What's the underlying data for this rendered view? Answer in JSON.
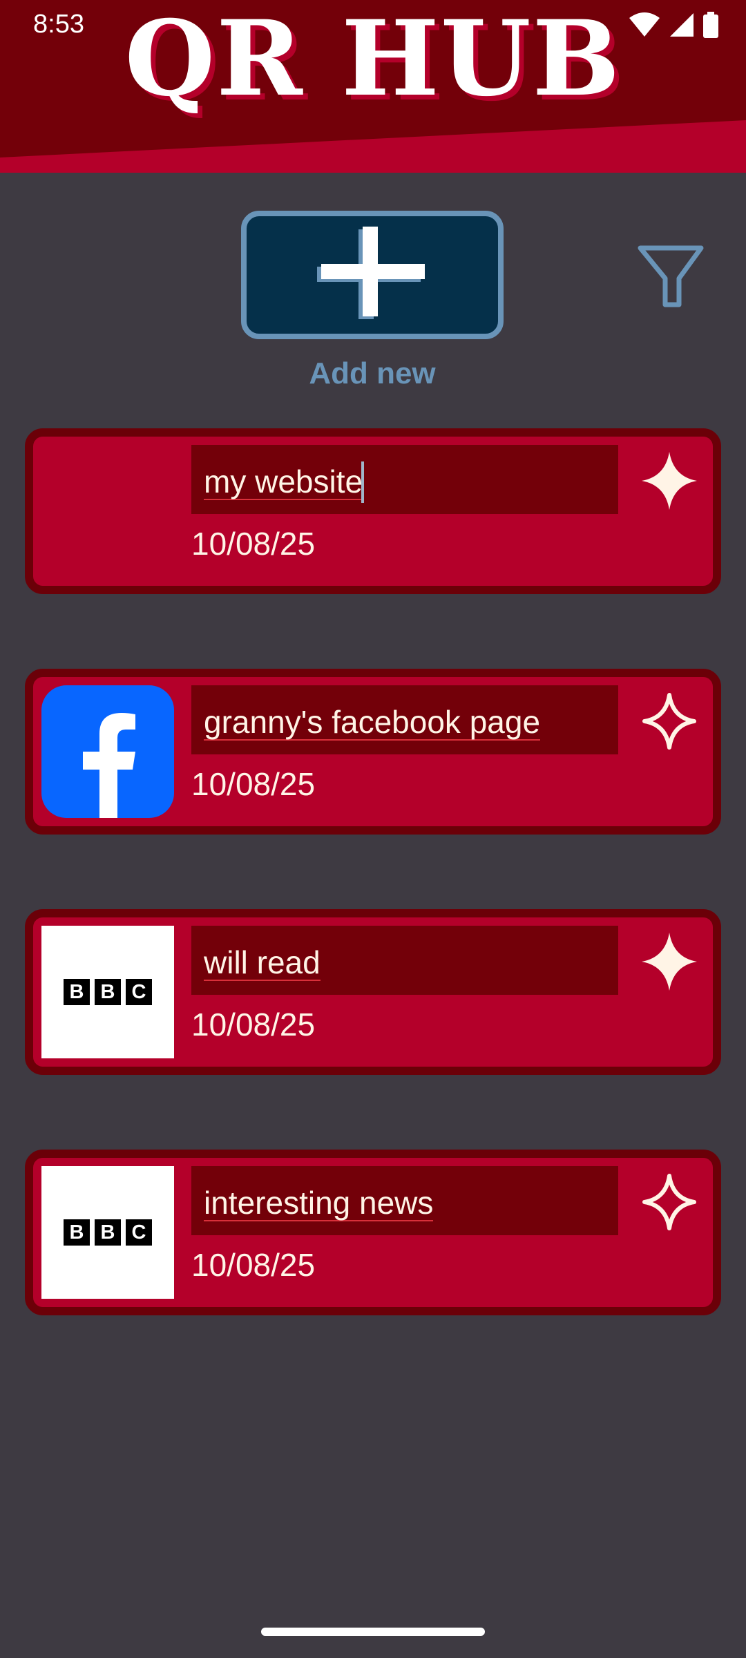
{
  "status_bar": {
    "time": "8:53",
    "icons": [
      "wifi-icon",
      "cellular-signal-icon",
      "battery-icon"
    ]
  },
  "header": {
    "title": "QR HUB"
  },
  "toolbar": {
    "add_label": "Add new",
    "add_icon": "plus-icon",
    "filter_icon": "filter-icon"
  },
  "cards": [
    {
      "name": "my website",
      "date": "10/08/25",
      "thumbnail": "none",
      "favorite": true,
      "editing": true
    },
    {
      "name": "granny's facebook page",
      "date": "10/08/25",
      "thumbnail": "facebook-logo",
      "favorite": false,
      "editing": false
    },
    {
      "name": "will read",
      "date": "10/08/25",
      "thumbnail": "bbc-logo",
      "favorite": true,
      "editing": false
    },
    {
      "name": "interesting news",
      "date": "10/08/25",
      "thumbnail": "bbc-logo",
      "favorite": false,
      "editing": false
    }
  ],
  "bbc_logo_letters": [
    "B",
    "B",
    "C"
  ],
  "colors": {
    "background": "#3e3a42",
    "banner_dark": "#730009",
    "banner_accent": "#b4002a",
    "card_fill": "#b4002a",
    "card_border": "#6b0008",
    "field_fill": "#730009",
    "text_light": "#fff4e6",
    "add_button_fill": "#05304a",
    "add_button_accent": "#6994b8",
    "facebook_blue": "#0866ff"
  }
}
